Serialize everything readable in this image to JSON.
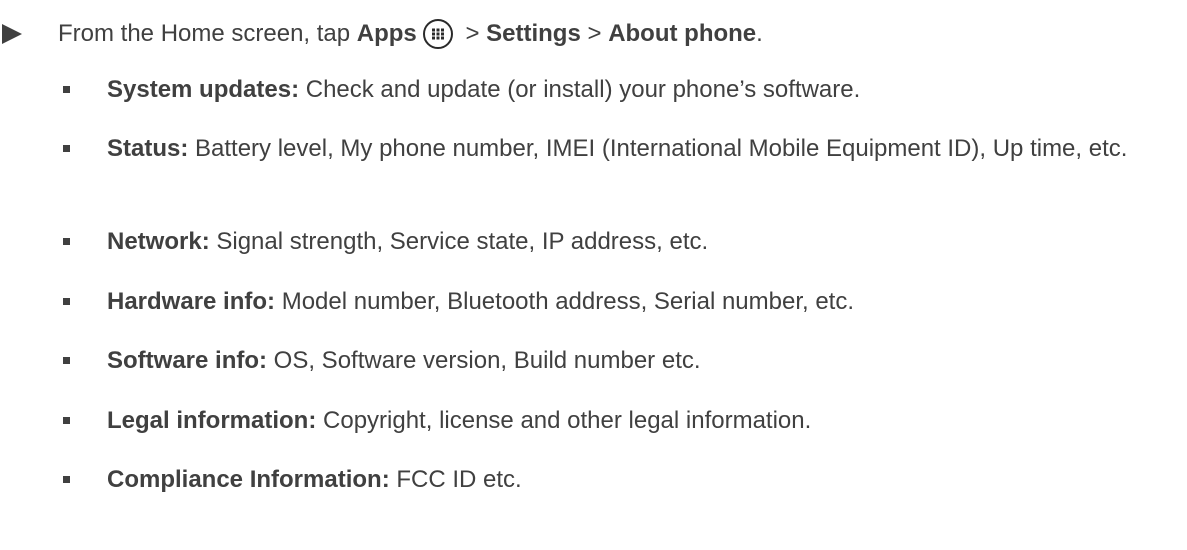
{
  "instruction": {
    "prefix": "From the Home screen, tap ",
    "apps": "Apps",
    "sep1": " > ",
    "settings": "Settings",
    "sep2": " > ",
    "about": "About phone",
    "suffix": ".",
    "apps_icon": "apps-grid-icon"
  },
  "items": [
    {
      "label": "System updates:",
      "text": " Check and update (or install) your phone’s software."
    },
    {
      "label": "Status:",
      "text": " Battery level, My phone number, IMEI (International Mobile Equipment ID), Up time, etc."
    },
    {
      "label": "Network:",
      "text": " Signal strength, Service state, IP address, etc."
    },
    {
      "label": "Hardware info:",
      "text": " Model number, Bluetooth address, Serial number, etc."
    },
    {
      "label": "Software info:",
      "text": " OS, Software version, Build number etc."
    },
    {
      "label": "Legal information:",
      "text": " Copyright, license and other legal information."
    },
    {
      "label": "Compliance Information:",
      "text": " FCC ID etc."
    }
  ]
}
